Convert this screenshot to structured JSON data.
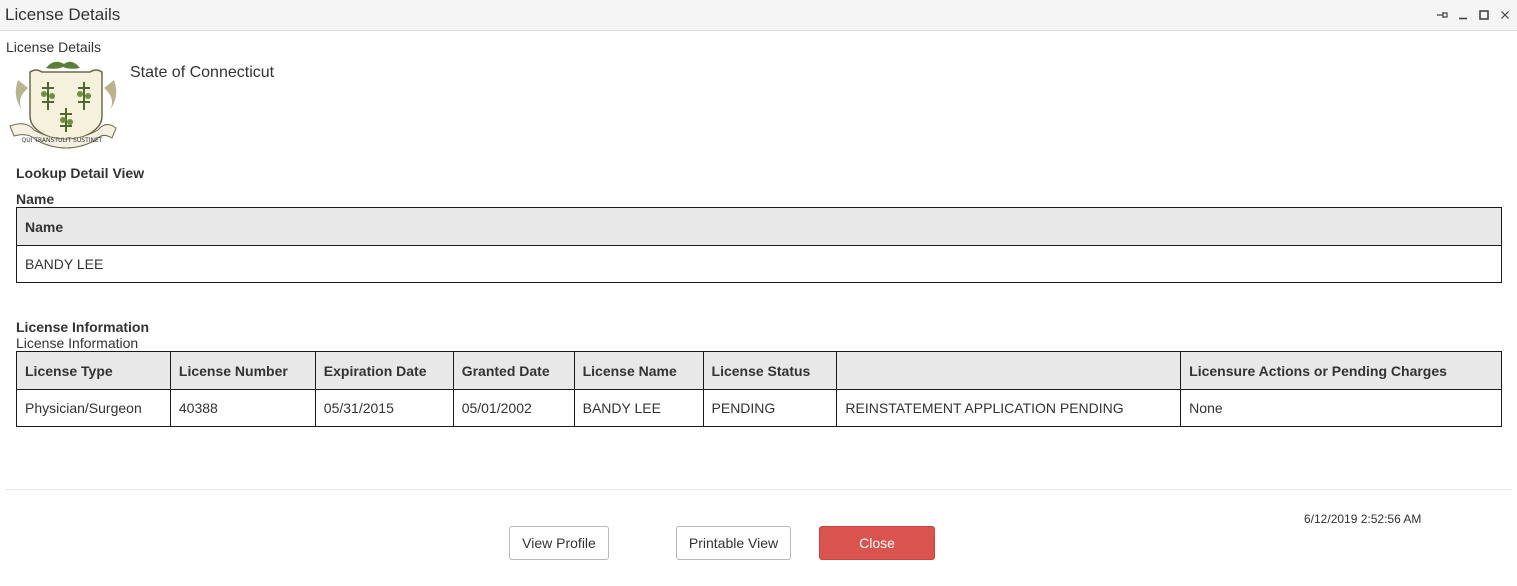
{
  "window": {
    "title": "License Details",
    "controls": [
      "pin-icon",
      "minimize-icon",
      "maximize-icon",
      "close-icon"
    ]
  },
  "header": {
    "subtitle": "License Details",
    "agency_name": "State of Connecticut",
    "seal_motto": "QUI TRANSTULIT SUSTINET"
  },
  "lookup": {
    "title": "Lookup Detail View",
    "name_section": "Name",
    "name_table": {
      "columns": [
        "Name"
      ],
      "rows": [
        [
          "BANDY LEE"
        ]
      ]
    }
  },
  "license": {
    "title": "License Information",
    "subtitle": "License Information",
    "table": {
      "columns": [
        "License Type",
        "License Number",
        "Expiration Date",
        "Granted Date",
        "License Name",
        "License Status",
        "",
        "Licensure Actions or Pending Charges"
      ],
      "rows": [
        [
          "Physician/Surgeon",
          "40388",
          "05/31/2015",
          "05/01/2002",
          "BANDY LEE",
          "PENDING",
          "REINSTATEMENT APPLICATION PENDING",
          "None"
        ]
      ]
    }
  },
  "footer": {
    "timestamp": "6/12/2019 2:52:56 AM",
    "view_profile": "View Profile",
    "printable_view": "Printable View",
    "close": "Close"
  },
  "colors": {
    "close_button": "#d9534f",
    "table_header_bg": "#e8e8e8",
    "titlebar_bg": "#f5f5f5"
  }
}
